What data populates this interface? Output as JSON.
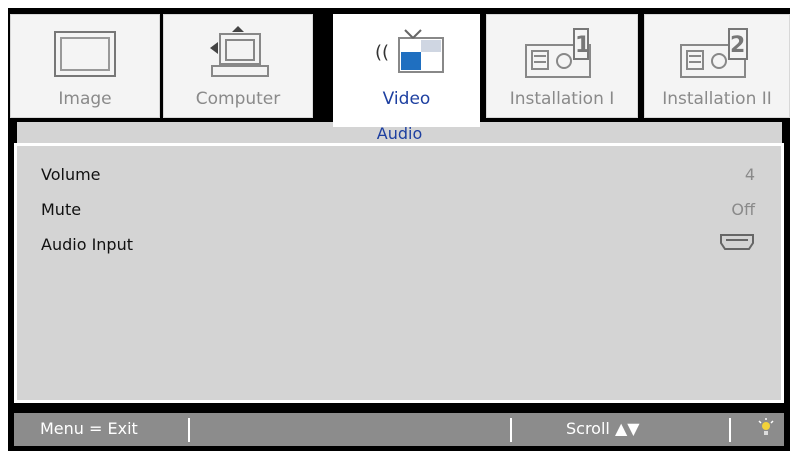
{
  "tabs": [
    {
      "label": "Image",
      "icon": "image-frame-icon",
      "active": false
    },
    {
      "label": "Computer",
      "icon": "computer-icon",
      "active": false
    },
    {
      "label": "Video",
      "icon": "video-tv-icon",
      "active": true
    },
    {
      "label": "Installation I",
      "icon": "projector-1-icon",
      "active": false
    },
    {
      "label": "Installation II",
      "icon": "projector-2-icon",
      "active": false
    }
  ],
  "section": {
    "title": "Audio"
  },
  "settings": [
    {
      "label": "Volume",
      "value": "4"
    },
    {
      "label": "Mute",
      "value": "Off"
    },
    {
      "label": "Audio Input",
      "value_icon": "hdmi-port-icon"
    }
  ],
  "footer": {
    "menu_hint": "Menu = Exit",
    "scroll_hint": "Scroll ▲▼",
    "indicator_icon": "lamp-icon"
  },
  "colors": {
    "accent_text": "#1d3fa0",
    "panel_bg": "#d4d4d4",
    "footer_bg": "#8c8c8c",
    "frame": "#000000"
  }
}
